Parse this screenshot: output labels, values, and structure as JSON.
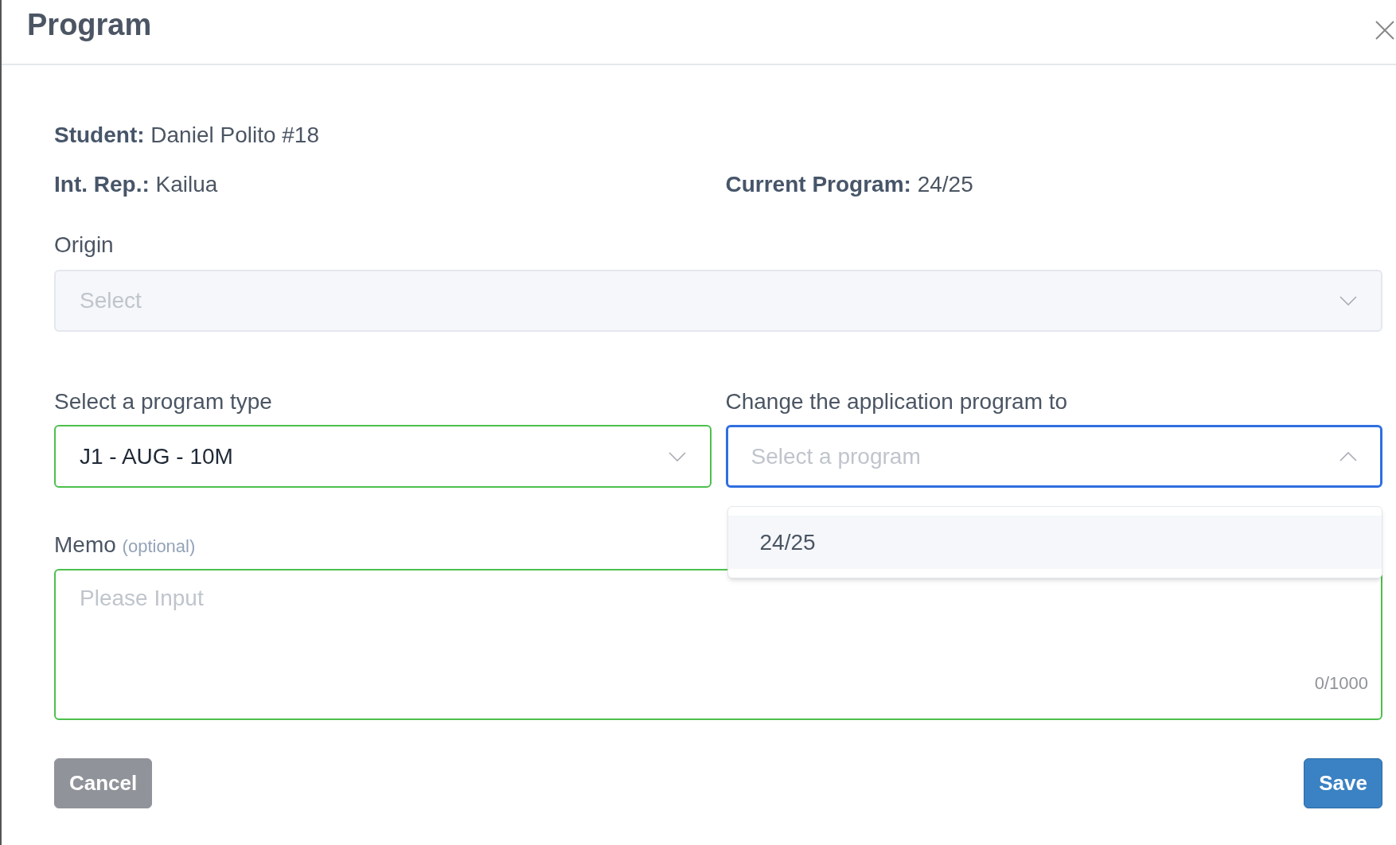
{
  "dialog": {
    "title": "Program"
  },
  "info": [
    {
      "label": "Student:",
      "value": "Daniel Polito #18"
    },
    {
      "label": "Int. Rep.:",
      "value": "Kailua"
    },
    {
      "label": "Current Program:",
      "value": "24/25"
    }
  ],
  "origin": {
    "label": "Origin",
    "placeholder": "Select",
    "disabled": true
  },
  "program_type": {
    "label": "Select a program type",
    "value": "J1 - AUG - 10M",
    "valid": true
  },
  "application_program": {
    "label": "Change the application program to",
    "placeholder": "Select a program",
    "expanded": true,
    "options": [
      {
        "label": "24/25",
        "highlighted": true
      }
    ]
  },
  "memo": {
    "label": "Memo",
    "hint": "(optional)",
    "placeholder": "Please Input",
    "counter": "0/1000",
    "valid": true
  },
  "buttons": [
    {
      "label": "Cancel",
      "kind": "secondary"
    },
    {
      "label": "Save",
      "kind": "primary"
    }
  ]
}
